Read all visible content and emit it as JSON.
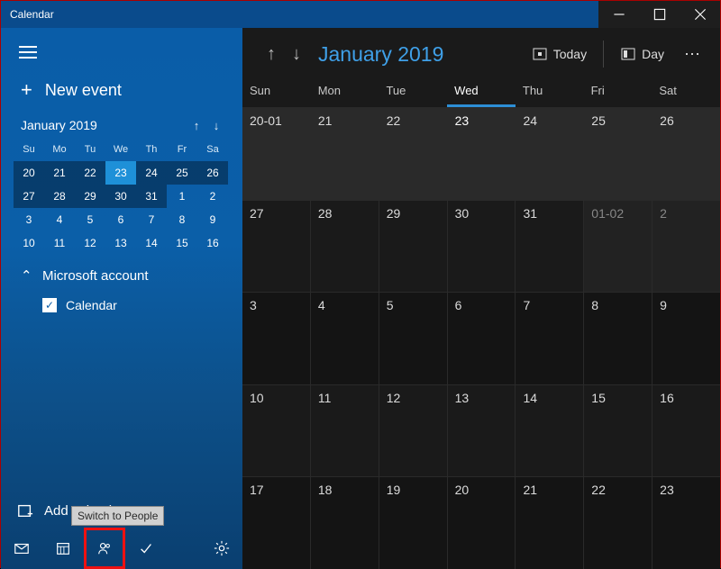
{
  "titlebar": {
    "title": "Calendar"
  },
  "sidebar": {
    "new_event": "New event",
    "month_label": "January 2019",
    "day_abbr": [
      "Su",
      "Mo",
      "Tu",
      "We",
      "Th",
      "Fr",
      "Sa"
    ],
    "weeks": [
      [
        "20",
        "21",
        "22",
        "23",
        "24",
        "25",
        "26"
      ],
      [
        "27",
        "28",
        "29",
        "30",
        "31",
        "1",
        "2"
      ],
      [
        "3",
        "4",
        "5",
        "6",
        "7",
        "8",
        "9"
      ],
      [
        "10",
        "11",
        "12",
        "13",
        "14",
        "15",
        "16"
      ]
    ],
    "account_label": "Microsoft account",
    "calendar_label": "Calendar",
    "add_calendars": "Add calendars",
    "tooltip": "Switch to People"
  },
  "header": {
    "month": "January 2019",
    "today": "Today",
    "day": "Day"
  },
  "grid": {
    "day_names": [
      "Sun",
      "Mon",
      "Tue",
      "Wed",
      "Thu",
      "Fri",
      "Sat"
    ],
    "rows": [
      [
        "20-01",
        "21",
        "22",
        "23",
        "24",
        "25",
        "26"
      ],
      [
        "27",
        "28",
        "29",
        "30",
        "31",
        "01-02",
        "2"
      ],
      [
        "3",
        "4",
        "5",
        "6",
        "7",
        "8",
        "9"
      ],
      [
        "10",
        "11",
        "12",
        "13",
        "14",
        "15",
        "16"
      ],
      [
        "17",
        "18",
        "19",
        "20",
        "21",
        "22",
        "23"
      ]
    ]
  }
}
